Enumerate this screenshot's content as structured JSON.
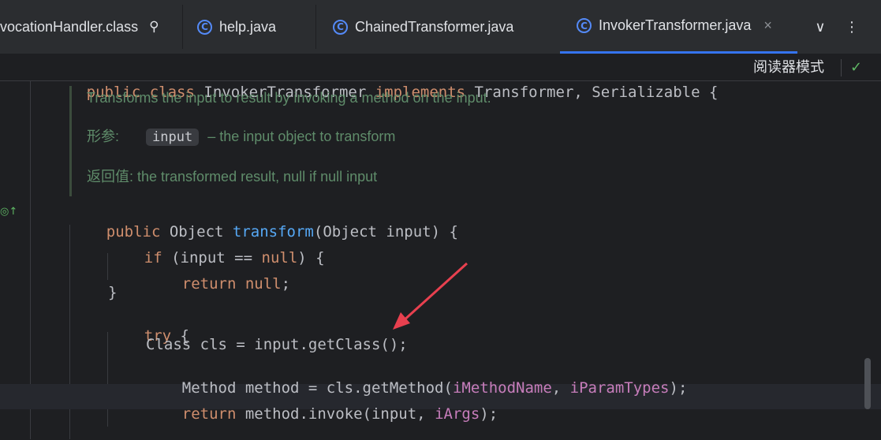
{
  "tabs": [
    {
      "label": "vocationHandler.class",
      "pin_icon": "pin-icon"
    },
    {
      "label": "help.java",
      "icon": "C"
    },
    {
      "label": "ChainedTransformer.java",
      "icon": "C"
    },
    {
      "label": "InvokerTransformer.java",
      "icon": "C",
      "close": "×"
    }
  ],
  "tab_actions": {
    "dropdown": "∨",
    "more": "⋮"
  },
  "sticky_line": {
    "kw1": "public",
    "kw2": "class",
    "name": " InvokerTransformer ",
    "kw3": "implements",
    "rest": " Transformer, Serializable {"
  },
  "reader_mode": {
    "label": "阅读器模式",
    "check": "✓"
  },
  "doc": {
    "summary": "Transforms the input to result by invoking a method on the input.",
    "params_label": "形参:",
    "param_name": "input",
    "param_desc": "– the input object to transform",
    "returns_label": "返回值:",
    "returns_desc": " the transformed result, null if null input"
  },
  "code": {
    "l1_kw": "public",
    "l1_type": " Object ",
    "l1_fn": "transform",
    "l1_rest": "(Object input) {",
    "l2_kw": "if",
    "l2_a": " (input == ",
    "l2_null": "null",
    "l2_b": ") {",
    "l3_kw": "return",
    "l3_sp": " ",
    "l3_null": "null",
    "l3_end": ";",
    "l4": "}",
    "l5_kw": "try",
    "l5_rest": " {",
    "l6": "Class cls = input.getClass();",
    "l7_a": "Method method = cls.getMethod(",
    "l7_f1": "iMethodName",
    "l7_b": ", ",
    "l7_f2": "iParamTypes",
    "l7_c": ");",
    "l8_kw": "return",
    "l8_a": " method.invoke(input, ",
    "l8_f": "iArgs",
    "l8_b": ");"
  },
  "colors": {
    "keyword": "#cf8e6d",
    "function": "#56a8f5",
    "field": "#c77dbb",
    "doc": "#5f8c6a",
    "arrow": "#e8404f",
    "accent": "#3574f0"
  }
}
